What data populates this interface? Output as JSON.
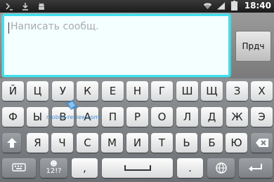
{
  "status_bar": {
    "icons_left": [
      "usb-debug-icon",
      "download-icon",
      "android-icon"
    ],
    "icons_right": [
      "wifi-icon",
      "signal-icon",
      "battery-icon"
    ],
    "time": "18:40"
  },
  "compose": {
    "placeholder": "Написать сообщ.",
    "send_label": "Прдч"
  },
  "keyboard": {
    "row1": [
      "Й",
      "Ц",
      "У",
      "К",
      "Е",
      "Н",
      "Г",
      "Ш",
      "Щ",
      "З",
      "Х"
    ],
    "row2": [
      "Ф",
      "Ы",
      "В",
      "А",
      "П",
      "Р",
      "О",
      "Л",
      "Д",
      "Ж",
      "Э"
    ],
    "row3": [
      "Я",
      "Ч",
      "С",
      "М",
      "И",
      "Т",
      "Ь",
      "Б",
      "Ю"
    ],
    "shift_icon": "shift-arrow-icon",
    "backspace_icon": "backspace-icon",
    "settings_icon": "keyboard-settings-icon",
    "num_key_top": "☻",
    "num_key_label": "12!?",
    "comma": ",",
    "space_icon": "space-bar-icon",
    "period": ".",
    "lang_icon": "globe-language-icon",
    "enter_icon": "enter-arrow-icon"
  },
  "watermark": {
    "text": "mobile-review.com"
  },
  "colors": {
    "input_border": "#3fe0f0",
    "input_bg": "#f4ffff",
    "keyboard_bg": "#7d8185"
  }
}
